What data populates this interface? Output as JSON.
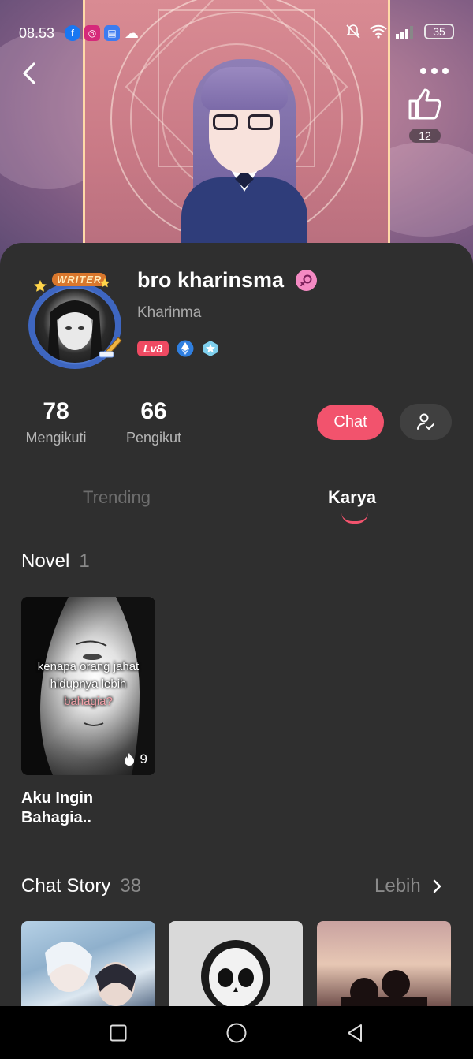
{
  "status_bar": {
    "time": "08.53",
    "battery": "35"
  },
  "header": {
    "like_count": "12"
  },
  "profile": {
    "name": "bro kharinsma",
    "username": "Kharinma",
    "writer_badge": "WRITER",
    "level": "Lv8"
  },
  "stats": [
    {
      "value": "78",
      "label": "Mengikuti"
    },
    {
      "value": "66",
      "label": "Pengikut"
    }
  ],
  "actions": {
    "chat_label": "Chat"
  },
  "tabs": [
    {
      "label": "Trending",
      "active": false
    },
    {
      "label": "Karya",
      "active": true
    }
  ],
  "novel_section": {
    "title": "Novel",
    "count": "1",
    "items": [
      {
        "title": "Aku Ingin Bahagia..",
        "cover_text_line1": "kenapa orang jahat",
        "cover_text_line2": "hidupnya lebih",
        "cover_text_line3": "bahagia?",
        "views": "9"
      }
    ]
  },
  "chat_story_section": {
    "title": "Chat Story",
    "count": "38",
    "more_label": "Lebih"
  },
  "colors": {
    "accent": "#f2536d",
    "background": "#2f2f2f",
    "muted": "#8a8a8a"
  }
}
